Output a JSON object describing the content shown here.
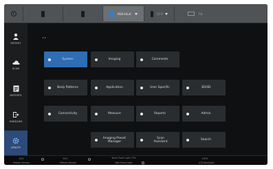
{
  "topbar": {
    "mode": "MSK-Adult",
    "probe_label": "C2-9",
    "cell_label": "Tilt"
  },
  "sidebar": {
    "items": [
      {
        "label": "PATIENT",
        "icon": "patient-icon"
      },
      {
        "label": "SCAN",
        "icon": "cloud-icon"
      },
      {
        "label": "REPORTS",
        "icon": "report-icon"
      },
      {
        "label": "ENDEXAM",
        "icon": "exit-icon"
      },
      {
        "label": "UTILITY",
        "icon": "gear-icon",
        "active": true
      }
    ]
  },
  "breadcrumb": "▸ ▸",
  "buttons": {
    "system": "System",
    "imaging": "Imaging",
    "comments": "Comments",
    "body_patterns": "Body Patterns",
    "application": "Application",
    "user_specific": "User Specific",
    "3d4d": "3D/4D",
    "connectivity": "Connectivity",
    "measure": "Measure",
    "reports": "Reports",
    "admin": "Admin",
    "imaging_preset_manager": "Imaging Preset Manager",
    "scan_assistant": "Scan Assistant",
    "search": "Search"
  },
  "statusbar": {
    "master_volume_value": "40%",
    "master_volume_label": "Master Volume",
    "effects_volume_value": "90%",
    "effects_volume_label": "Effects Volume",
    "touch_panel_value": "Touch Panel Light\n70%",
    "touch_panel_label": "Wall Panel Light",
    "lcd_value": "100%",
    "lcd_label": "LCD Backlight"
  },
  "colors": {
    "accent": "#2f6db5",
    "sidebar_active": "#2d4a78",
    "mode_highlight": "#2f7fd6"
  }
}
